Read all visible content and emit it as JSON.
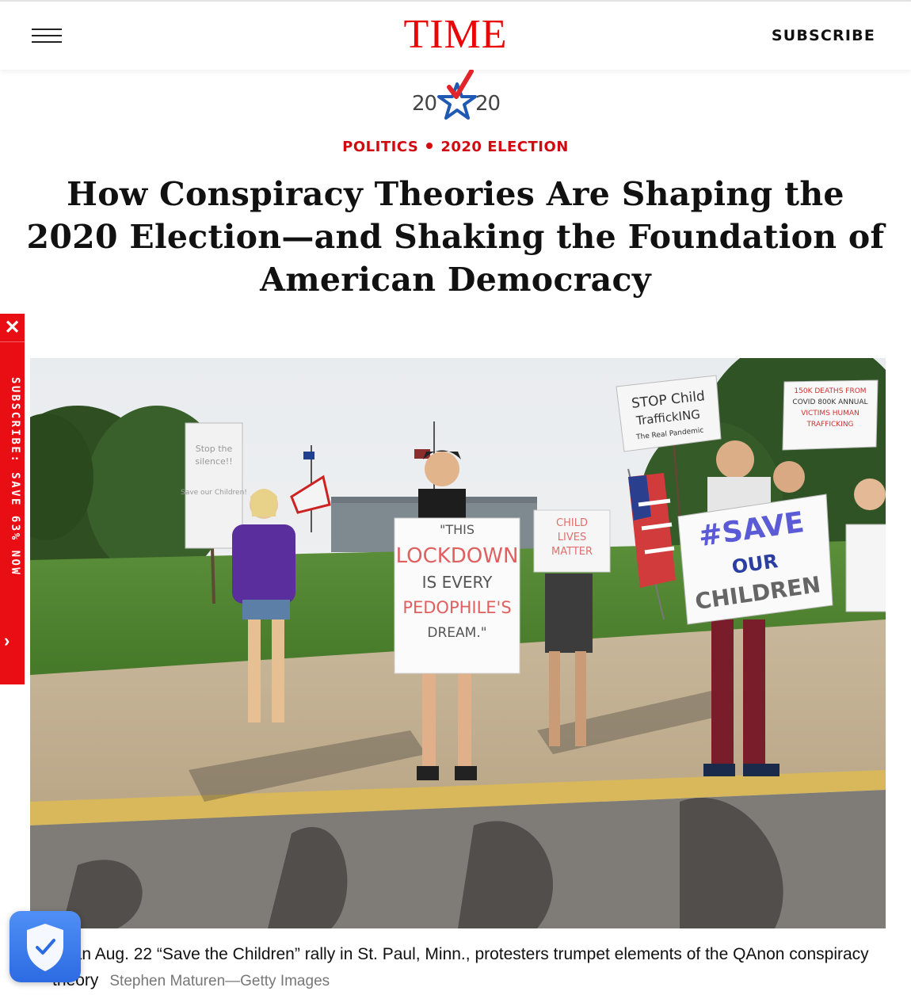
{
  "header": {
    "logo": "TIME",
    "subscribe_label": "SUBSCRIBE",
    "logo_color": "#e90606"
  },
  "badge": {
    "left_digits": "20",
    "right_digits": "20",
    "icon": "star-check-icon"
  },
  "kicker": {
    "section": "POLITICS",
    "topic": "2020 ELECTION",
    "color": "#d10a11"
  },
  "article": {
    "headline": "How Conspiracy Theories Are Shaping the 2020 Election—and Shaking the Foundation of American Democracy"
  },
  "side_tab": {
    "close_label": "✕",
    "text": "SUBSCRIBE: SAVE 63% NOW",
    "arrow": "›",
    "color": "#e90e14"
  },
  "photo": {
    "signs": {
      "lockdown_1": "\"THIS",
      "lockdown_2": "LOCKDOWN",
      "lockdown_3": "IS EVERY",
      "lockdown_4": "PEDOPHILE'S",
      "lockdown_5": "DREAM.\"",
      "save_1": "#SAVE",
      "save_2": "OUR",
      "save_3": "CHILDREN",
      "child_lives_1": "CHILD",
      "child_lives_2": "LIVES",
      "child_lives_3": "MATTER",
      "stop_1": "STOP Child",
      "stop_2": "TraffickING",
      "stop_3": "The Real Pandemic",
      "covid_1": "150K DEATHS FROM",
      "covid_2": "COVID 800K ANNUAL",
      "covid_3": "VICTIMS HUMAN",
      "covid_4": "TRAFFICKING",
      "left_sign_1": "Stop the",
      "left_sign_2": "silence!!",
      "left_sign_3": "Save our Children!"
    }
  },
  "caption": {
    "text": "At an Aug. 22 “Save the Children” rally in St. Paul, Minn., protesters trumpet elements of the QAnon conspiracy theory",
    "credit": "Stephen Maturen—Getty Images"
  }
}
